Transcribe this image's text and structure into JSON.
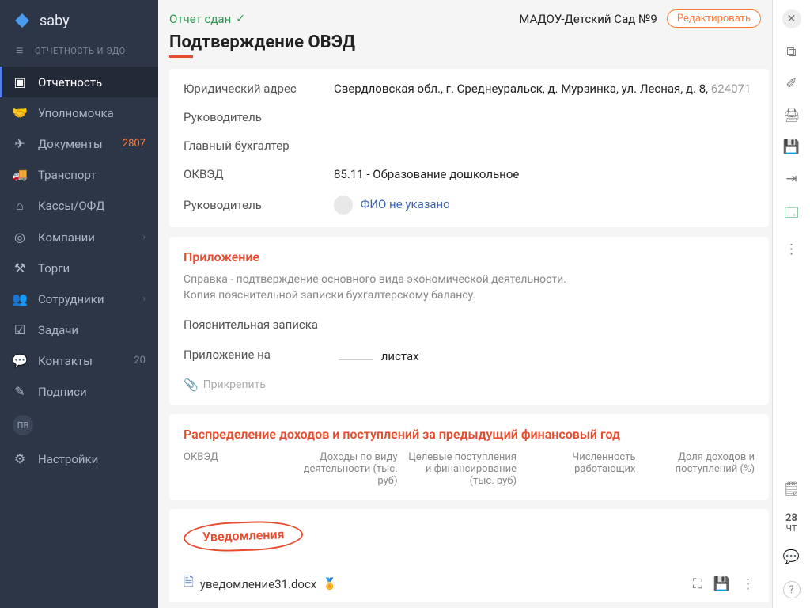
{
  "brand": "saby",
  "section_label": "ОТЧЕТНОСТЬ И ЭДО",
  "nav": {
    "reports": "Отчетность",
    "proxy": "Уполномочка",
    "docs": "Документы",
    "docs_badge": "2807",
    "transport": "Транспорт",
    "kassy": "Кассы/ОФД",
    "companies": "Компании",
    "torgi": "Торги",
    "employees": "Сотрудники",
    "tasks": "Задачи",
    "contacts": "Контакты",
    "contacts_badge": "20",
    "signatures": "Подписи",
    "avatar": "ПВ",
    "settings": "Настройки"
  },
  "header": {
    "status": "Отчет сдан",
    "org": "МАДОУ-Детский Сад №9",
    "edit": "Редактировать"
  },
  "title": "Подтверждение ОВЭД",
  "fields": {
    "addr_label": "Юридический адрес",
    "addr_value": "Свердловская обл., г. Среднеуральск, д. Мурзинка, ул. Лесная, д. 8, ",
    "addr_postal": "624071",
    "director_label": "Руководитель",
    "accountant_label": "Главный бухгалтер",
    "okved_label": "ОКВЭД",
    "okved_value": "85.11 - Образование дошкольное",
    "director2_label": "Руководитель",
    "director2_value": "ФИО не указано"
  },
  "appendix": {
    "title": "Приложение",
    "desc1": "Справка - подтверждение основного вида экономической деятельности.",
    "desc2": "Копия пояснительной записки бухгалтерскому балансу.",
    "note_label": "Пояснительная записка",
    "sheets_label": "Приложение на",
    "sheets_unit": "листах",
    "attach": "Прикрепить"
  },
  "income": {
    "title": "Распределение доходов и поступлений за предыдущий финансовый год",
    "col1": "ОКВЭД",
    "col2": "Доходы по виду деятельности (тыс. руб)",
    "col3": "Целевые поступления и финансирование (тыс. руб)",
    "col4": "Численность работающих",
    "col5": "Доля доходов и поступлений (%)"
  },
  "notifications": {
    "title": "Уведомления",
    "file": "уведомление31.docx"
  },
  "date": {
    "day": "28",
    "dow": "ЧТ"
  }
}
